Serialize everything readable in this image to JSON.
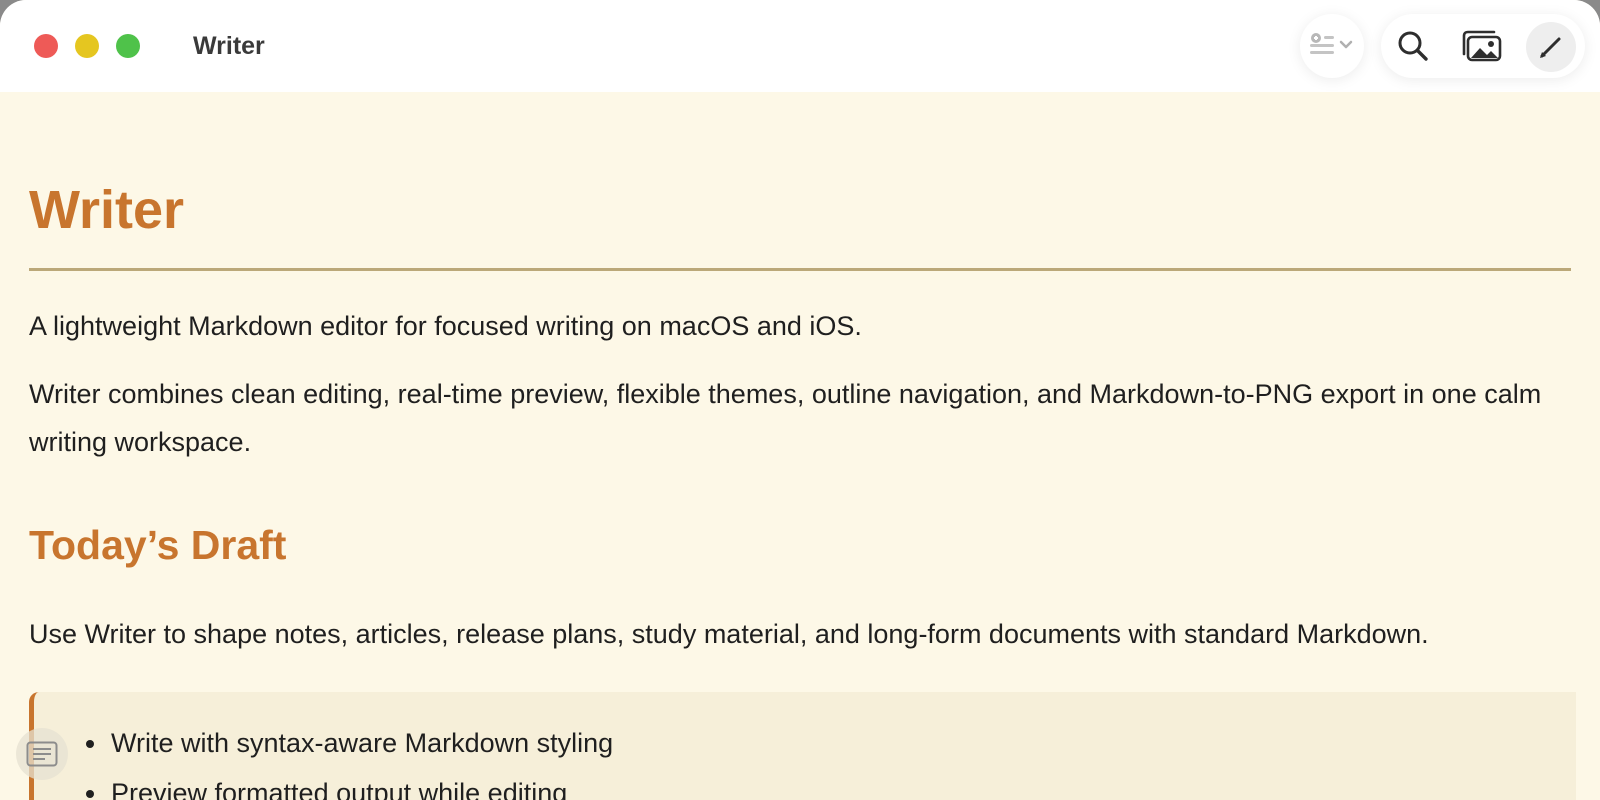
{
  "window": {
    "title": "Writer"
  },
  "toolbar": {
    "outline_menu_icon": "list-outline-icon",
    "search_icon": "search-icon",
    "export_image_icon": "photo-stack-icon",
    "edit_icon": "pencil-icon"
  },
  "document": {
    "title": "Writer",
    "intro": "A lightweight Markdown editor for focused writing on macOS and iOS.",
    "description": "Writer combines clean editing, real-time preview, flexible themes, outline navigation, and Markdown-to-PNG export in one calm writing workspace.",
    "section_heading": "Today’s Draft",
    "section_text": "Use Writer to shape notes, articles, release plans, study material, and long-form documents with standard Markdown.",
    "callout_items": [
      "Write with syntax-aware Markdown styling",
      "Preview formatted output while editing"
    ]
  },
  "colors": {
    "accent": "#c8752e",
    "paper": "#fdf8e7",
    "callout": "#f6efd9",
    "rule": "#bba879"
  }
}
